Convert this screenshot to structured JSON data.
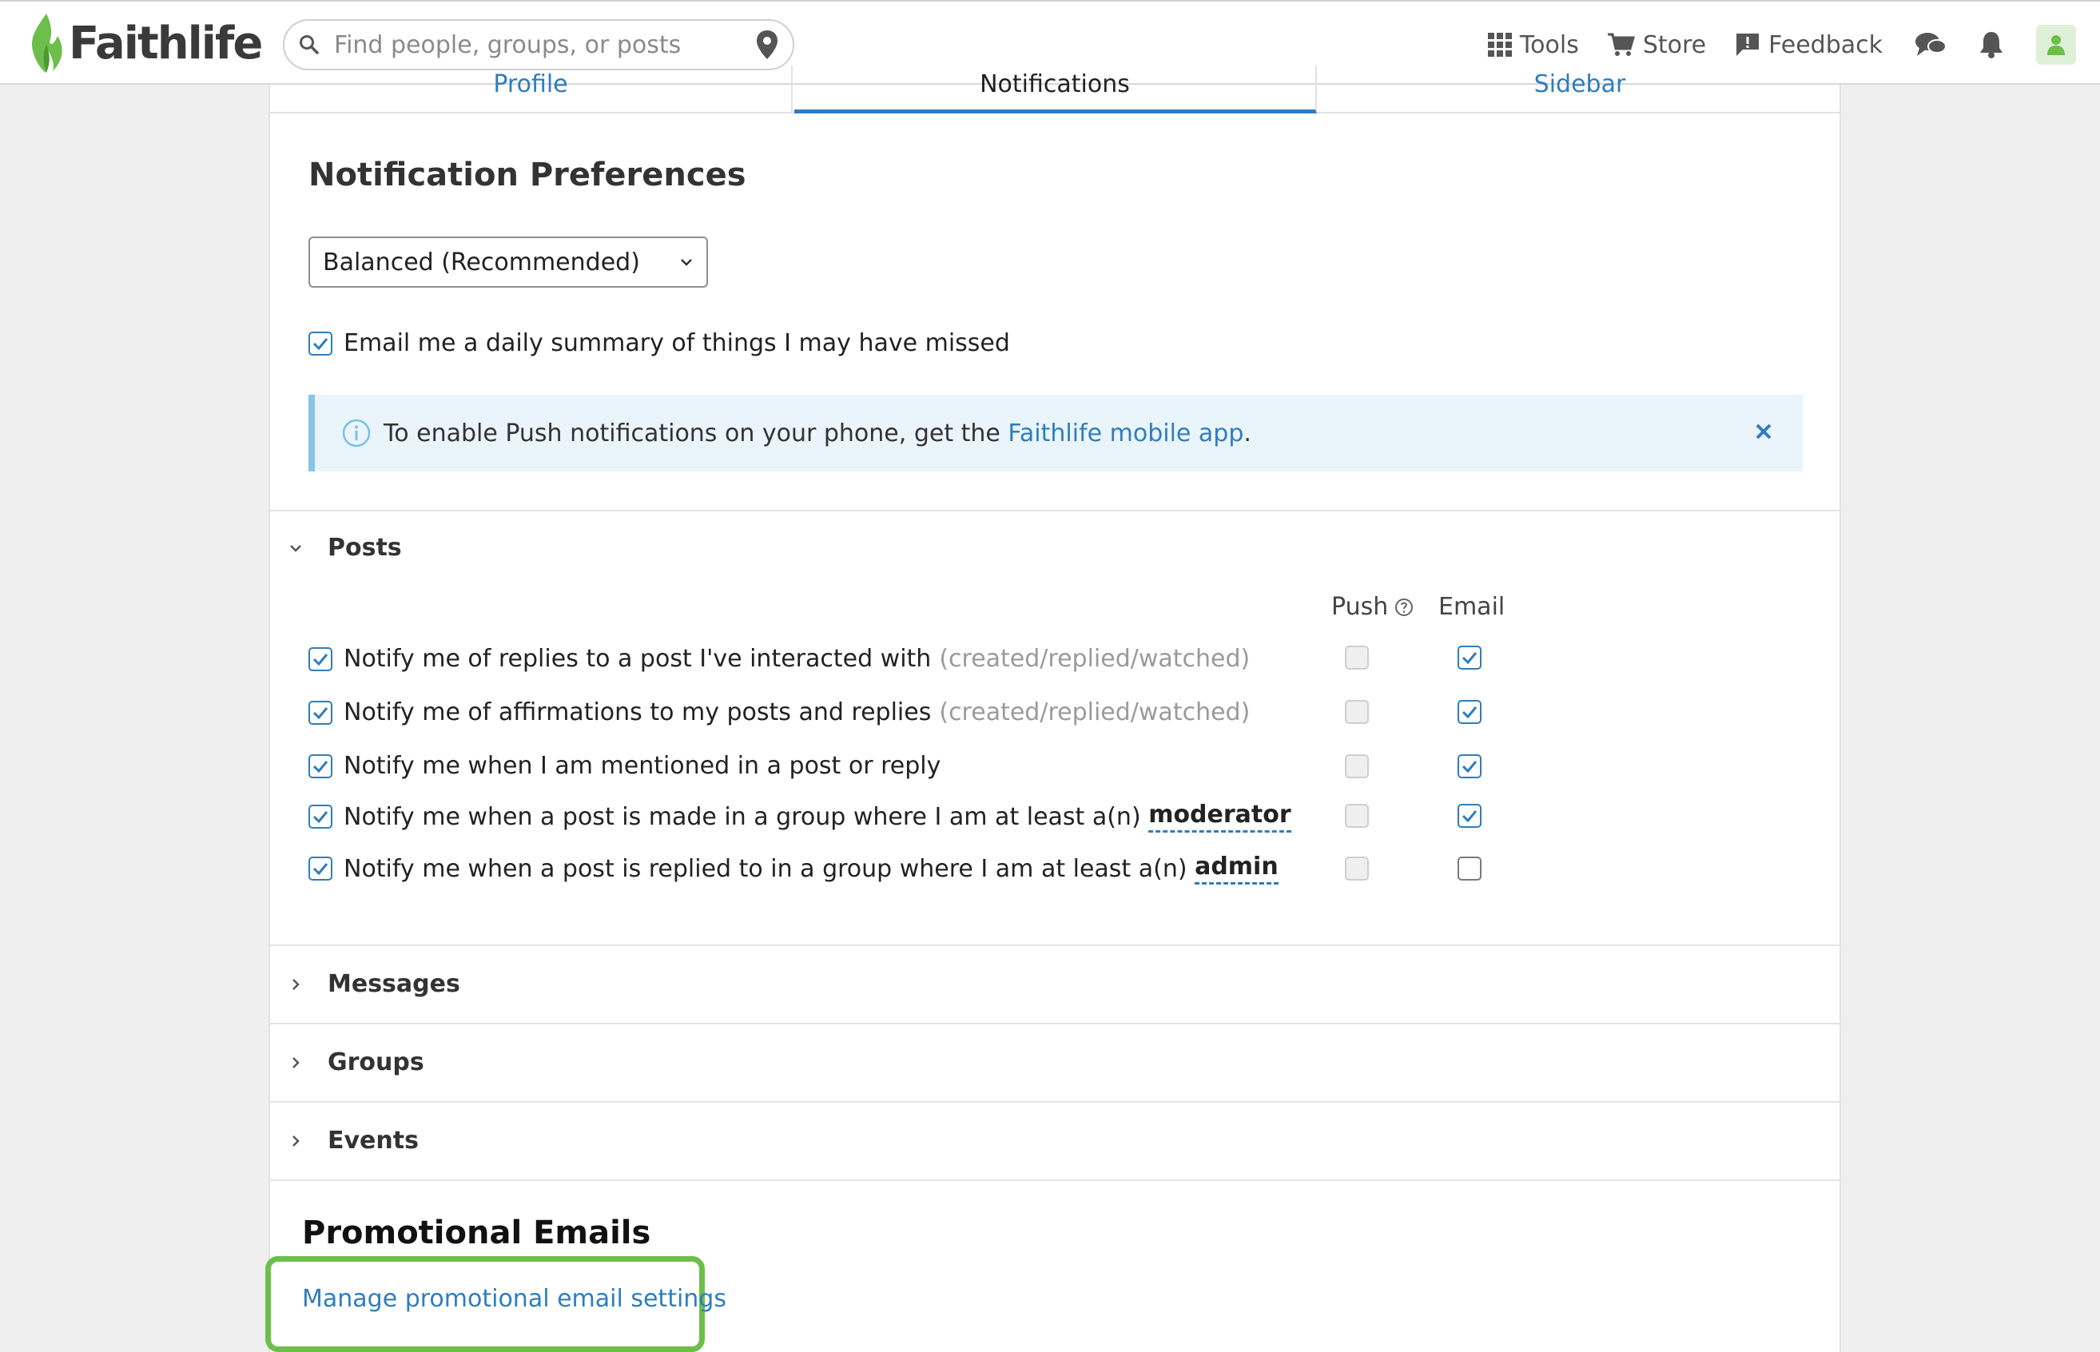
{
  "header": {
    "logo_text": "Faithlife",
    "search_placeholder": "Find people, groups, or posts",
    "nav": {
      "tools": "Tools",
      "store": "Store",
      "feedback": "Feedback"
    }
  },
  "tabs": [
    {
      "label": "Profile"
    },
    {
      "label": "Notifications"
    },
    {
      "label": "Sidebar"
    }
  ],
  "page_title": "Notification Preferences",
  "preset_select": {
    "value": "Balanced (Recommended)"
  },
  "daily_summary": {
    "label": "Email me a daily summary of things I may have missed",
    "checked": true
  },
  "alert": {
    "text": "To enable Push notifications on your phone, get the ",
    "link": "Faithlife mobile app",
    "suffix": "."
  },
  "posts": {
    "title": "Posts",
    "columns": {
      "push": "Push",
      "email": "Email"
    },
    "rows": [
      {
        "label": "Notify me of replies to a post I've interacted with",
        "muted": "(created/replied/watched)",
        "email": true
      },
      {
        "label": "Notify me of affirmations to my posts and replies",
        "muted": "(created/replied/watched)",
        "email": true
      },
      {
        "label": "Notify me when I am mentioned in a post or reply",
        "email": true
      },
      {
        "label": "Notify me when a post is made in a group where I am at least a(n) ",
        "role": "moderator",
        "email": true
      },
      {
        "label": "Notify me when a post is replied to in a group where I am at least a(n) ",
        "role": "admin",
        "email": false
      }
    ]
  },
  "sections": {
    "messages": "Messages",
    "groups": "Groups",
    "events": "Events"
  },
  "promo": {
    "title": "Promotional Emails",
    "link": "Manage promotional email settings"
  },
  "colors": {
    "accent": "#2f7dbd",
    "brand_green": "#6cbf4a"
  }
}
